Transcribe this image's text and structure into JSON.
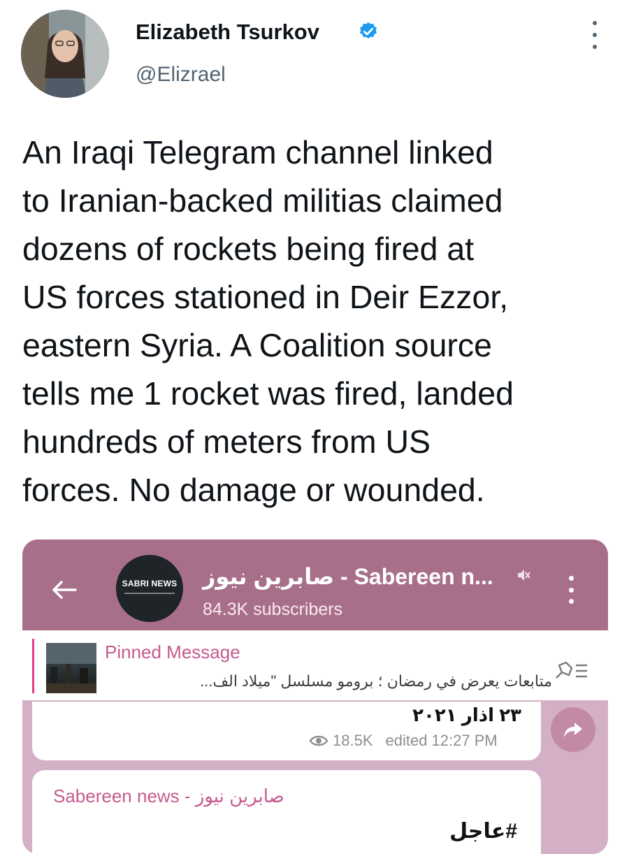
{
  "author": {
    "name": "Elizabeth Tsurkov",
    "handle": "@Elizrael",
    "verified": true
  },
  "tweet": {
    "text": "An Iraqi Telegram channel linked\nto Iranian-backed militias claimed\ndozens of rockets being fired at\nUS forces stationed in Deir Ezzor,\neastern Syria. A Coalition source\ntells me 1 rocket was fired, landed\nhundreds of meters from US\nforces. No damage or wounded."
  },
  "telegram": {
    "channel_title": "صابرين نيوز - Sabereen n...",
    "subscribers": "84.3K subscribers",
    "logo_text": "SABRI NEWS",
    "pinned": {
      "title": "Pinned Message",
      "text": "متابعات  يعرض في رمضان ؛ برومو مسلسل \"ميلاد الف..."
    },
    "message1": {
      "date": "٢٣ اذار ٢٠٢١",
      "views": "18.5K",
      "edited": "edited 12:27 PM"
    },
    "message2": {
      "author": "Sabereen news - صابرين نيوز",
      "text": "#عاجل"
    }
  },
  "colors": {
    "telegram_header": "#a86f8a",
    "telegram_background": "#d4b0c6",
    "accent_pink": "#c75a8e",
    "verified_blue": "#1d9bf0"
  }
}
